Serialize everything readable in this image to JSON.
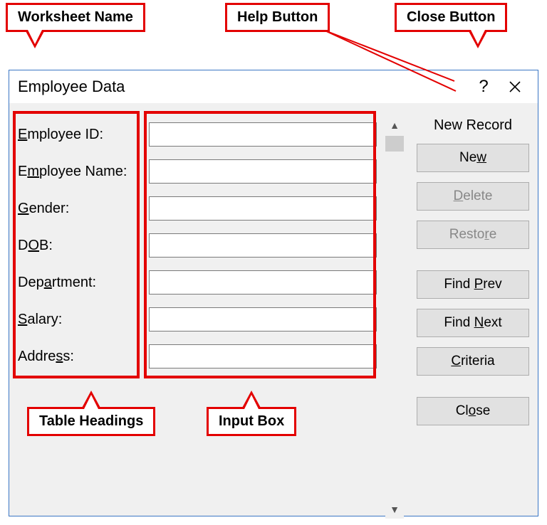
{
  "callouts": {
    "worksheet_name": "Worksheet Name",
    "help_button": "Help Button",
    "close_button": "Close Button",
    "table_headings": "Table Headings",
    "input_box": "Input Box"
  },
  "dialog": {
    "title": "Employee Data",
    "status": "New Record",
    "fields": {
      "employee_id": {
        "label_pre": "",
        "ul": "E",
        "label_post": "mployee ID:",
        "value": ""
      },
      "employee_name": {
        "label_pre": "E",
        "ul": "m",
        "label_post": "ployee Name:",
        "value": ""
      },
      "gender": {
        "label_pre": "",
        "ul": "G",
        "label_post": "ender:",
        "value": ""
      },
      "dob": {
        "label_pre": "D",
        "ul": "O",
        "label_post": "B:",
        "value": ""
      },
      "department": {
        "label_pre": "Dep",
        "ul": "a",
        "label_post": "rtment:",
        "value": ""
      },
      "salary": {
        "label_pre": "",
        "ul": "S",
        "label_post": "alary:",
        "value": ""
      },
      "address": {
        "label_pre": "Addre",
        "ul": "s",
        "label_post": "s:",
        "value": ""
      }
    },
    "buttons": {
      "new": {
        "pre": "Ne",
        "ul": "w",
        "post": ""
      },
      "delete": {
        "pre": "",
        "ul": "D",
        "post": "elete"
      },
      "restore": {
        "pre": "Resto",
        "ul": "r",
        "post": "e"
      },
      "find_prev": {
        "pre": "Find ",
        "ul": "P",
        "post": "rev"
      },
      "find_next": {
        "pre": "Find ",
        "ul": "N",
        "post": "ext"
      },
      "criteria": {
        "pre": "",
        "ul": "C",
        "post": "riteria"
      },
      "close": {
        "pre": "Cl",
        "ul": "o",
        "post": "se"
      }
    }
  }
}
